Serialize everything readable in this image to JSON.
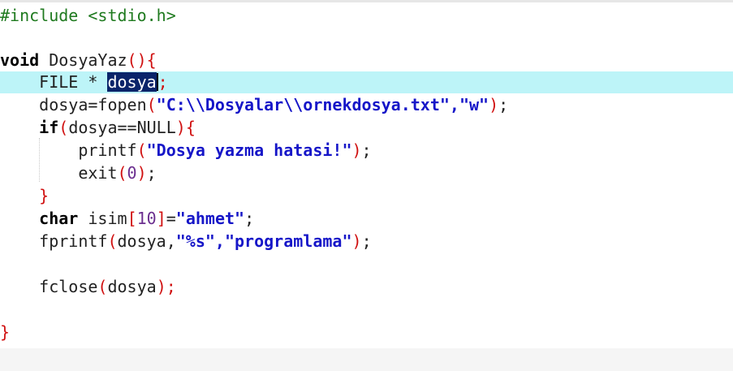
{
  "editor": {
    "lines": {
      "l1": "#include <stdio.h>",
      "l3_kw": "void",
      "l3_name": " DosyaYaz",
      "l3_paren_open": "(",
      "l3_paren_close": ")",
      "l3_brace": "{",
      "l4_indent": "    FILE * ",
      "l4_selected": "dosya",
      "l4_semicolon": ";",
      "l5_a": "    dosya=fopen",
      "l5_paren_open": "(",
      "l5_str1": "\"C:\\\\Dosyalar\\\\ornekdosya.txt\"",
      "l5_comma": ",",
      "l5_str2": "\"w\"",
      "l5_paren_close": ")",
      "l5_semicolon": ";",
      "l6_indent": "    ",
      "l6_kw": "if",
      "l6_paren_open": "(",
      "l6_cond": "dosya==NULL",
      "l6_paren_close": ")",
      "l6_brace": "{",
      "l7_a": "        printf",
      "l7_paren_open": "(",
      "l7_str": "\"Dosya yazma hatasi!\"",
      "l7_paren_close": ")",
      "l7_semicolon": ";",
      "l8_a": "        exit",
      "l8_paren_open": "(",
      "l8_num": "0",
      "l8_paren_close": ")",
      "l8_semicolon": ";",
      "l9_brace": "    }",
      "l10_indent": "    ",
      "l10_kw": "char",
      "l10_a": " isim",
      "l10_br_open": "[",
      "l10_num": "10",
      "l10_br_close": "]",
      "l10_eq": "=",
      "l10_str": "\"ahmet\"",
      "l10_semicolon": ";",
      "l11_a": "    fprintf",
      "l11_paren_open": "(",
      "l11_b": "dosya,",
      "l11_str1": "\"%s\"",
      "l11_comma": ",",
      "l11_str2": "\"programlama\"",
      "l11_paren_close": ")",
      "l11_semicolon": ";",
      "l13_a": "    fclose",
      "l13_paren_open": "(",
      "l13_b": "dosya",
      "l13_paren_close": ")",
      "l13_semicolon": ";",
      "l15_brace": "}"
    }
  },
  "colors": {
    "background": "#ffffff",
    "current_line_highlight": "#bdf4f8",
    "selection": "#0a246a",
    "preprocessor": "#1f7a1f",
    "string": "#1616c8",
    "number": "#6b2f8f",
    "bracket": "#d01010"
  }
}
